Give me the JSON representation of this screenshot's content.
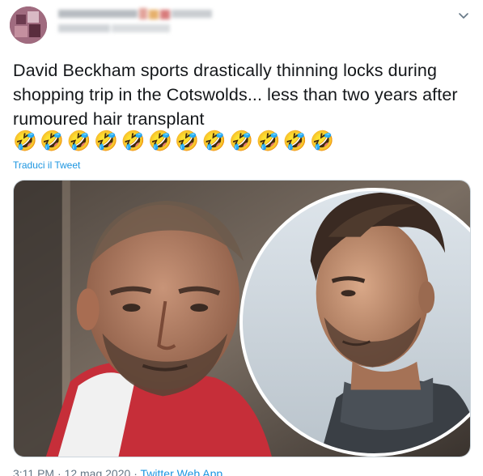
{
  "tweet": {
    "text": "David Beckham sports drastically thinning locks during shopping trip in the Cotswolds... less than two years after rumoured hair transplant",
    "emojis": [
      "🤣",
      "🤣",
      "🤣",
      "🤣",
      "🤣",
      "🤣",
      "🤣",
      "🤣",
      "🤣",
      "🤣",
      "🤣",
      "🤣"
    ],
    "translate_link": "Traduci il Tweet",
    "time": "3:11 PM",
    "dot": "·",
    "date": "12 mag 2020",
    "source": "Twitter Web App"
  },
  "icons": {
    "caret": "chevron-down-icon",
    "avatar": "avatar"
  },
  "colors": {
    "link": "#1b95e0",
    "text": "#14171a",
    "muted": "#657786"
  }
}
